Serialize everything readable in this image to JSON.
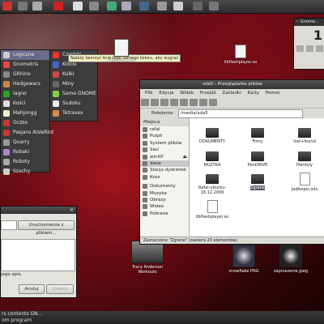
{
  "top_panel": {
    "icons": [
      "app-icon-1",
      "app-icon-2",
      "app-icon-3",
      "app-icon-4",
      "app-icon-5",
      "app-icon-6",
      "app-icon-7",
      "app-icon-8",
      "app-icon-9",
      "app-icon-10",
      "app-icon-11"
    ]
  },
  "games_menu": {
    "categories": [
      {
        "label": "Logiczne",
        "selected": true
      },
      {
        "label": "Gnometris"
      },
      {
        "label": "GRhino"
      },
      {
        "label": "Hedgewars"
      },
      {
        "label": "Iagno"
      },
      {
        "label": "Kości"
      },
      {
        "label": "Mahjongg"
      },
      {
        "label": "Oczko"
      },
      {
        "label": "Pasjans AisleRiot"
      },
      {
        "label": "Quarry"
      },
      {
        "label": "Robaki"
      },
      {
        "label": "Roboty"
      },
      {
        "label": "Szachy"
      }
    ],
    "submenu": [
      {
        "label": "Czwórki"
      },
      {
        "label": "Klocki"
      },
      {
        "label": "Kulki"
      },
      {
        "label": "Miny"
      },
      {
        "label": "Same GNOME"
      },
      {
        "label": "Sudoku"
      },
      {
        "label": "Tetravex"
      }
    ],
    "tooltip": "Należy tworzyć linie tego samego koloru, aby wygrać"
  },
  "desktop": {
    "icons": [
      {
        "label": "Jadłospis.ods"
      },
      {
        "label": "libflashplayer.so"
      },
      {
        "label": "Tracy Anderson Workouts"
      },
      {
        "label": "snowflake.PNG"
      },
      {
        "label": "zaproszenie.jpeg"
      }
    ]
  },
  "mini_window": {
    "title": "Gnome...",
    "value": "1"
  },
  "file_manager": {
    "title": "sda5 - Przeglądarka plików",
    "menu": [
      "Plik",
      "Edycja",
      "Widok",
      "Przejdź",
      "Zakładki",
      "Karty",
      "Pomoc"
    ],
    "location_label": "Położenie:",
    "location_value": "/media/sda5",
    "sidebar_header": "Miejsca",
    "places": [
      "rafal",
      "Pulpit",
      "System plików",
      "Sieć",
      "winXP",
      "dane",
      "Stacja dyskietek",
      "Kosz",
      "Dokumenty",
      "Muzyka",
      "Obrazy",
      "Wideo",
      "Pobrane"
    ],
    "files": [
      {
        "name": "DOKUMENTY",
        "type": "folder"
      },
      {
        "name": "Filmy",
        "type": "folder"
      },
      {
        "name": "lost+found",
        "type": "folder"
      },
      {
        "name": "MUZYKA",
        "type": "folder"
      },
      {
        "name": "PenDRIVE",
        "type": "folder"
      },
      {
        "name": "Pierdoly",
        "type": "folder"
      },
      {
        "name": "Rafal-ubuntu-16.12.2009",
        "type": "folder"
      },
      {
        "name": "Zgrane",
        "type": "folder",
        "selected": true
      },
      {
        "name": "Jadłospis.ods",
        "type": "file"
      },
      {
        "name": "libflashplayer.so",
        "type": "file"
      }
    ],
    "status": "Zaznaczono \"Zgrane\" (zawiera 20 elementów)"
  },
  "dialog": {
    "choose_button": "Uruchomienie z plikiem...",
    "text": "jego opis.",
    "cancel": "Anuluj",
    "ok": "Utwórz"
  },
  "bottom_panel": {
    "line1": "rs contents GN...",
    "line2": "om program"
  }
}
